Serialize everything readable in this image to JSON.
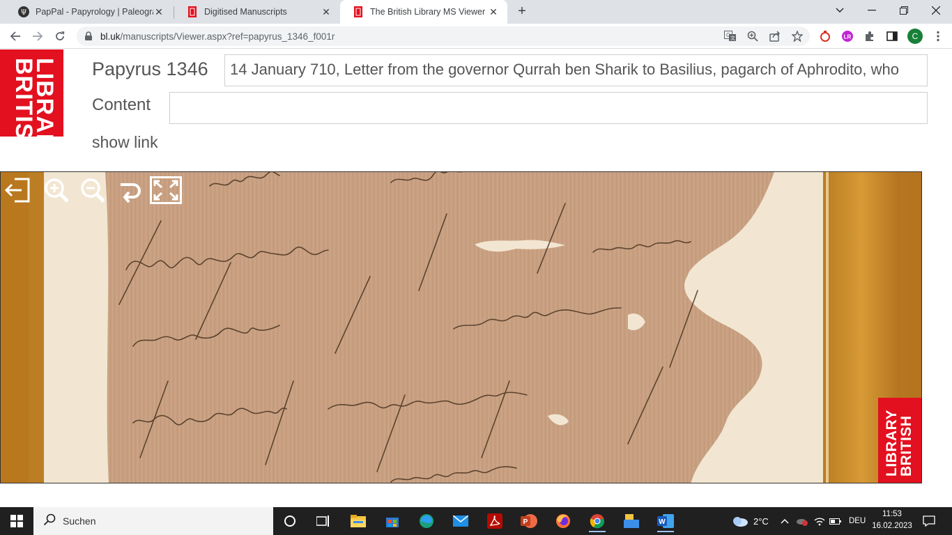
{
  "browser": {
    "tabs": [
      {
        "title": "PapPal - Papyrology | Paleograph",
        "active": false
      },
      {
        "title": "Digitised Manuscripts",
        "active": false
      },
      {
        "title": "The British Library MS Viewer",
        "active": true
      }
    ],
    "new_tab": "+",
    "url_domain": "bl.uk",
    "url_rest": "/manuscripts/Viewer.aspx?ref=papyrus_1346_f001r",
    "profile_initial": "C"
  },
  "page": {
    "logo_text": "BRITISH LIBRARY",
    "logo_line1": "BRITISH",
    "logo_line2": "LIBRARY",
    "manuscript_title": "Papyrus 1346",
    "description": "14 January 710, Letter from the governor Qurrah ben Sharik to Basilius, pagarch of Aphrodito, who",
    "content_label": "Content",
    "content_value": "",
    "show_link": "show link"
  },
  "viewer": {
    "tools": [
      "exit-icon",
      "zoom-in-icon",
      "zoom-out-icon",
      "rotate-icon",
      "fullscreen-icon"
    ],
    "watermark_line1": "BRITISH",
    "watermark_line2": "LIBRARY"
  },
  "taskbar": {
    "search_label": "Suchen",
    "weather": "2°C",
    "language": "DEU",
    "time": "11:53",
    "date": "16.02.2023"
  }
}
